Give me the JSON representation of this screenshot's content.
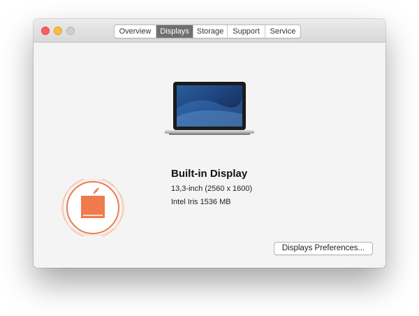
{
  "window": {
    "traffic_lights": [
      "close",
      "minimize",
      "zoom"
    ]
  },
  "tabs": [
    {
      "label": "Overview",
      "selected": false
    },
    {
      "label": "Displays",
      "selected": true
    },
    {
      "label": "Storage",
      "selected": false
    },
    {
      "label": "Support",
      "selected": false
    },
    {
      "label": "Service",
      "selected": false
    }
  ],
  "display": {
    "name": "Built-in Display",
    "size_resolution": "13,3-inch (2560 x 1600)",
    "graphics": "Intel Iris 1536 MB"
  },
  "buttons": {
    "preferences_label": "Displays Preferences..."
  },
  "icons": {
    "laptop": "laptop-icon",
    "watermark": "apple-logo-watermark"
  },
  "colors": {
    "selected_tab": "#6f6f6f",
    "close": "#fc605c",
    "minimize": "#fdbc40",
    "zoom_inactive": "#cfcfcf",
    "watermark": "#f07a4c"
  }
}
